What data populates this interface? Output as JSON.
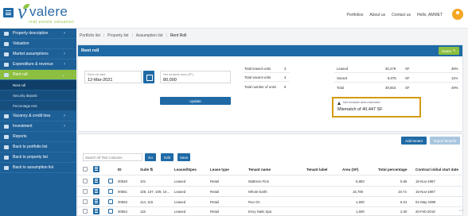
{
  "header": {
    "logo_main": "valere",
    "logo_sub": "real estate valuation",
    "nav": [
      "Portfolios",
      "About us",
      "Contact us",
      "Hello, AMMET"
    ]
  },
  "sidebar": {
    "items": [
      {
        "label": "Property description",
        "chevron": true
      },
      {
        "label": "Valuation",
        "chevron": false
      },
      {
        "label": "Market assumptions",
        "chevron": true
      },
      {
        "label": "Expenditure & revenue",
        "chevron": true
      },
      {
        "label": "Rent roll",
        "chevron": true,
        "active": true
      },
      {
        "label": "Vacancy & credit loss",
        "chevron": true
      },
      {
        "label": "Investment",
        "chevron": true
      },
      {
        "label": "Reports",
        "chevron": false
      },
      {
        "label": "Back to portfolio list",
        "chevron": false
      },
      {
        "label": "Back to property list",
        "chevron": false
      },
      {
        "label": "Back to assumption list",
        "chevron": false
      }
    ],
    "subitems": [
      "Rent roll",
      "Security deposit",
      "Percentage rent"
    ]
  },
  "breadcrumb": [
    "Portfolio list",
    "Property list",
    "Assumption list",
    "Rent Roll"
  ],
  "rentroll": {
    "title": "Rent roll",
    "notes_label": "Notes",
    "date_label": "Rent roll date",
    "date_value": "12-Mar-2021",
    "area_label": "Net rentable area (SF)",
    "area_value": "80,000",
    "update_label": "Update",
    "unit_stats": [
      {
        "label": "Total leased units",
        "value": "3"
      },
      {
        "label": "Total vacant units",
        "value": "3"
      },
      {
        "label": "Total number of units",
        "value": "6"
      }
    ],
    "area_stats": [
      {
        "label": "Leased",
        "value": "30,479",
        "unit": "SF",
        "pct": "38%"
      },
      {
        "label": "Vacant",
        "value": "8,075",
        "unit": "SF",
        "pct": "11%"
      },
      {
        "label": "Total",
        "value": "39,553",
        "unit": "SF",
        "pct": "49%"
      }
    ],
    "warning_label": "Net rentable area mismatch",
    "warning_value": "Mismatch of 40,447 SF"
  },
  "table": {
    "search_placeholder": "Search All Text Columns",
    "go_label": "Go",
    "edit_label": "Edit",
    "save_label": "Save",
    "add_tenant_label": "Add tenant",
    "import_tenants_label": "Import tenants",
    "columns": [
      "ID",
      "Suite",
      "Leased/Spec",
      "Lease type",
      "Tenant name",
      "Tenant label",
      "Area (SF)",
      "Total percentage",
      "Contract initial start date"
    ],
    "rows": [
      {
        "id": "00548",
        "suite": "101",
        "leased": "Leased",
        "type": "Retail",
        "tenant": "Mattress Firm",
        "label": "",
        "area": "6,883",
        "pct": "5.65",
        "start": "16-Nov-1997"
      },
      {
        "id": "00551",
        "suite": "105, 107, 109, 10...",
        "leased": "Leased",
        "type": "Retail",
        "tenant": "Whole Earth",
        "label": "",
        "area": "15,780",
        "pct": "19.74",
        "start": "15-Nov-1997"
      },
      {
        "id": "00553",
        "suite": "114, 115",
        "leased": "Leased",
        "type": "Retail",
        "tenant": "Run On",
        "label": "",
        "area": "1,600",
        "pct": "6.01",
        "start": "01-May-1999"
      },
      {
        "id": "00554",
        "suite": "116",
        "leased": "Leased",
        "type": "Retail",
        "tenant": "Envy Nails Spa",
        "label": "",
        "area": "1,600",
        "pct": "2.00",
        "start": "20-Feb-2019"
      }
    ],
    "scroll_hint": "< >"
  }
}
